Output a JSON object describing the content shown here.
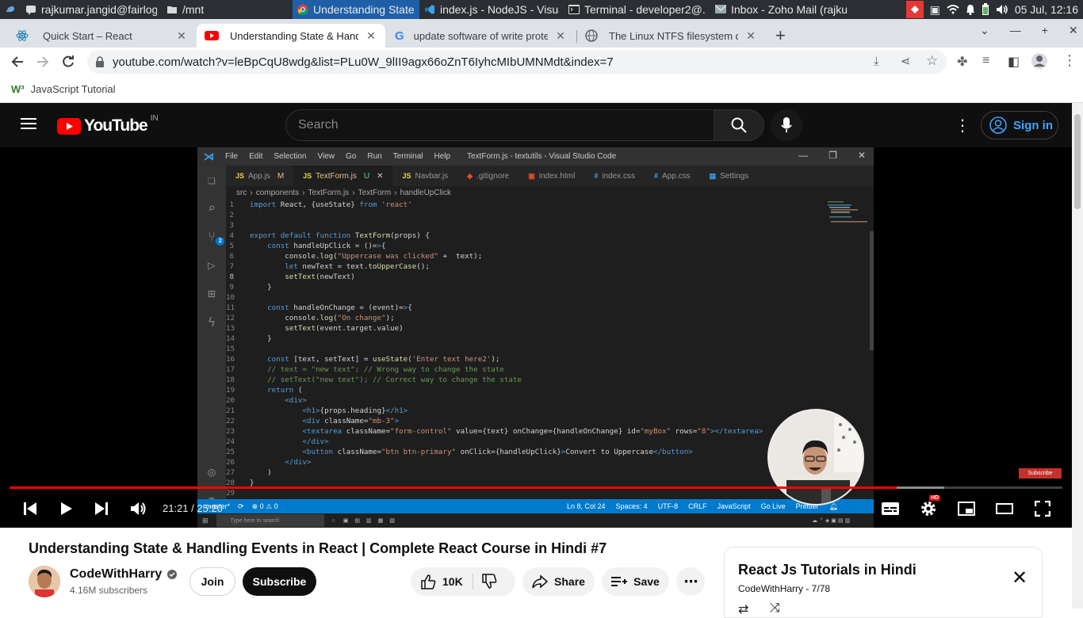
{
  "taskbar": {
    "items": [
      {
        "label": "rajkumar.jangid@fairlogs...",
        "icon": "chat-icon"
      },
      {
        "label": "/mnt",
        "icon": "folder-icon"
      },
      {
        "label": "Understanding State & H...",
        "icon": "chrome-icon",
        "active": true
      },
      {
        "label": "index.js - NodeJS - Visual ...",
        "icon": "vscode-icon"
      },
      {
        "label": "Terminal - developer2@...",
        "icon": "terminal-icon"
      },
      {
        "label": "Inbox - Zoho Mail (rajku...",
        "icon": "mail-icon"
      }
    ],
    "datetime": "05 Jul, 12:16"
  },
  "browser": {
    "tabs": [
      {
        "title": "Quick Start – React",
        "icon": "react-icon"
      },
      {
        "title": "Understanding State & Handling",
        "icon": "youtube-icon",
        "active": true
      },
      {
        "title": "update software of write protec",
        "icon": "google-icon"
      },
      {
        "title": "The Linux NTFS filesystem drive",
        "icon": "globe-icon"
      }
    ],
    "url": "youtube.com/watch?v=leBpCqU8wdg&list=PLu0W_9lII9agx66oZnT6IyhcMIbUMNMdt&index=7",
    "bookmark": "JavaScript Tutorial"
  },
  "youtube": {
    "logo_text": "YouTube",
    "region": "IN",
    "search_placeholder": "Search",
    "signin_label": "Sign in"
  },
  "vscode": {
    "menu": [
      "File",
      "Edit",
      "Selection",
      "View",
      "Go",
      "Run",
      "Terminal",
      "Help"
    ],
    "window_title": "TextForm.js - textutils - Visual Studio Code",
    "tabs": [
      {
        "label": "App.js",
        "badge": "M",
        "icon": "JS",
        "color": "#e8d44d"
      },
      {
        "label": "TextForm.js",
        "badge": "U",
        "icon": "JS",
        "color": "#e8d44d",
        "active": true
      },
      {
        "label": "Navbar.js",
        "icon": "JS",
        "color": "#e8d44d"
      },
      {
        "label": ".gitignore",
        "icon": "◆",
        "color": "#e44d26"
      },
      {
        "label": "index.html",
        "icon": "▣",
        "color": "#e44d26"
      },
      {
        "label": "index.css",
        "icon": "#",
        "color": "#42a5f5"
      },
      {
        "label": "App.css",
        "icon": "#",
        "color": "#42a5f5"
      },
      {
        "label": "Settings",
        "icon": "▤",
        "color": "#42a5f5"
      }
    ],
    "breadcrumb": [
      "src",
      "components",
      "TextForm.js",
      "TextForm",
      "handleUpClick"
    ],
    "lines": [
      "import React, {useState} from 'react'",
      "",
      "",
      "export default function TextForm(props) {",
      "    const handleUpClick = ()=>{",
      "        console.log(\"Uppercase was clicked\" +  text);",
      "        let newText = text.toUpperCase();",
      "        setText(newText)",
      "    }",
      "",
      "    const handleOnChange = (event)=>{",
      "        console.log(\"On change\");",
      "        setText(event.target.value)",
      "    }",
      "",
      "    const [text, setText] = useState('Enter text here2');",
      "    // text = \"new text\"; // Wrong way to change the state",
      "    // setText(\"new text\"); // Correct way to change the state",
      "    return (",
      "        <div>",
      "            <h1>{props.heading}</h1>",
      "            <div className=\"mb-3\">",
      "            <textarea className=\"form-control\" value={text} onChange={handleOnChange} id=\"myBox\" rows=\"8\"></textarea>",
      "            </div>",
      "            <button className=\"btn btn-primary\" onClick={handleUpClick}>Convert to Uppercase</button>",
      "        </div>",
      "    )",
      "}",
      ""
    ],
    "current_line": 8,
    "status": {
      "branch": "master*",
      "problems": "⊗ 0 ⚠ 0",
      "position": "Ln 8, Col 24",
      "spaces": "Spaces: 4",
      "encoding": "UTF-8",
      "eol": "CRLF",
      "language": "JavaScript",
      "golive": "Go Live",
      "prettier": "Prettier"
    },
    "win_search": "Type here to search",
    "activity_badge": "2"
  },
  "player": {
    "current_time": "21:21",
    "duration": "25:20",
    "time_display": "21:21 / 25:20",
    "progress_fraction": 0.8428,
    "loaded_fraction": 0.888,
    "hd_badge": "HD",
    "subscribe_watermark": "Subscribe"
  },
  "video": {
    "title": "Understanding State & Handling Events in React | Complete React Course in Hindi #7",
    "channel": "CodeWithHarry",
    "subscribers": "4.16M subscribers",
    "join_label": "Join",
    "subscribe_label": "Subscribe",
    "likes": "10K",
    "share_label": "Share",
    "save_label": "Save"
  },
  "playlist": {
    "title": "React Js Tutorials in Hindi",
    "subtitle": "CodeWithHarry - 7/78"
  }
}
